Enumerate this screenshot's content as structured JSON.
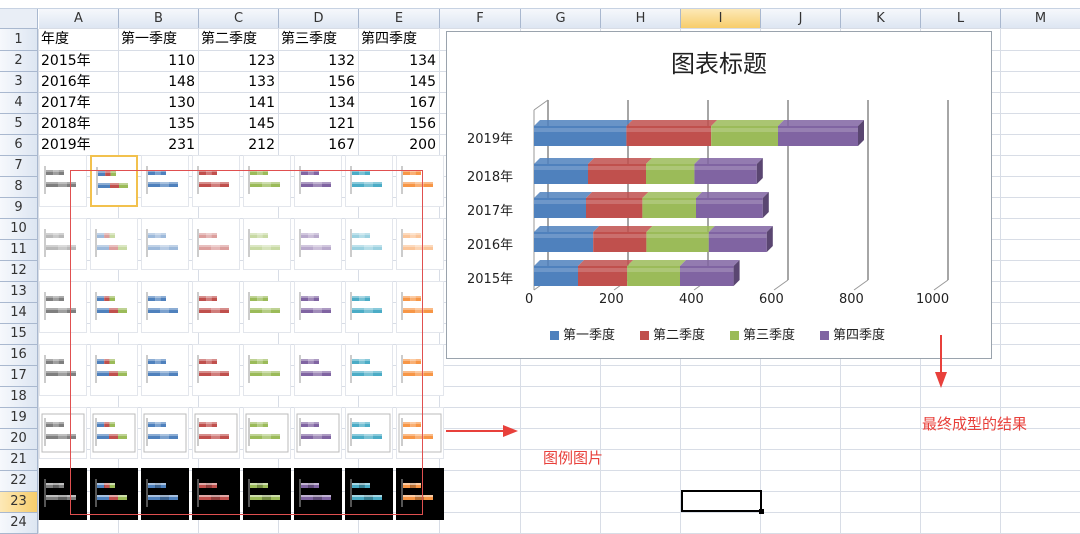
{
  "sheet": {
    "columns": [
      "A",
      "B",
      "C",
      "D",
      "E",
      "F",
      "G",
      "H",
      "I",
      "J",
      "K",
      "L",
      "M"
    ],
    "selected_column": "I",
    "rows": [
      "1",
      "2",
      "3",
      "4",
      "5",
      "6",
      "7",
      "8",
      "9",
      "10",
      "11",
      "12",
      "13",
      "14",
      "15",
      "16",
      "17",
      "18",
      "19",
      "20",
      "21",
      "22",
      "23",
      "24"
    ],
    "selected_row": "23",
    "table": {
      "header": [
        "年度",
        "第一季度",
        "第二季度",
        "第三季度",
        "第四季度"
      ],
      "rows": [
        [
          "2015年",
          "110",
          "123",
          "132",
          "134"
        ],
        [
          "2016年",
          "148",
          "133",
          "156",
          "145"
        ],
        [
          "2017年",
          "130",
          "141",
          "134",
          "167"
        ],
        [
          "2018年",
          "135",
          "145",
          "121",
          "156"
        ],
        [
          "2019年",
          "231",
          "212",
          "167",
          "200"
        ]
      ]
    }
  },
  "thumb_palette": [
    "#7f7f7f",
    "#4f81bd",
    "#4f81bd",
    "#c0504d",
    "#9bbb59",
    "#8064a2",
    "#4bacc6",
    "#f79646"
  ],
  "chart_data": {
    "type": "bar",
    "orientation": "horizontal",
    "stacked": true,
    "style": "3d",
    "title": "图表标题",
    "categories": [
      "2015年",
      "2016年",
      "2017年",
      "2018年",
      "2019年"
    ],
    "series": [
      {
        "name": "第一季度",
        "color": "#4f81bd",
        "values": [
          110,
          148,
          130,
          135,
          231
        ]
      },
      {
        "name": "第二季度",
        "color": "#c0504d",
        "values": [
          123,
          133,
          141,
          145,
          212
        ]
      },
      {
        "name": "第三季度",
        "color": "#9bbb59",
        "values": [
          132,
          156,
          134,
          121,
          167
        ]
      },
      {
        "name": "第四季度",
        "color": "#8064a2",
        "values": [
          134,
          145,
          167,
          156,
          200
        ]
      }
    ],
    "x_ticks": [
      "0",
      "200",
      "400",
      "600",
      "800",
      "1000"
    ],
    "xlim": [
      0,
      1000
    ],
    "grid": true,
    "legend_position": "bottom"
  },
  "annotations": {
    "legend_images": "图例图片",
    "final_result": "最终成型的结果"
  },
  "colors": {
    "annotation_red": "#e8403b"
  }
}
